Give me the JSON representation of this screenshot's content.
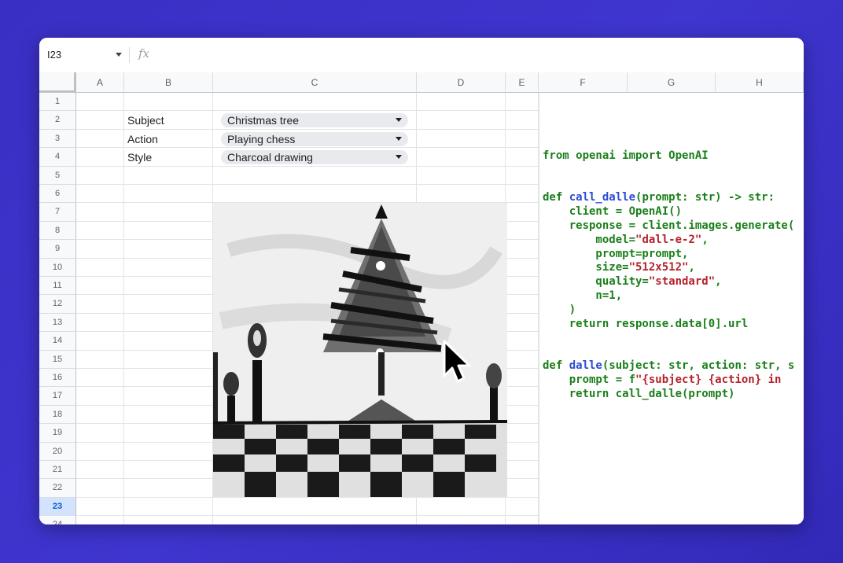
{
  "formula_bar": {
    "cell_ref": "I23",
    "fx_symbol": "fx",
    "formula": ""
  },
  "columns": [
    "A",
    "B",
    "C",
    "D",
    "E",
    "F",
    "G",
    "H"
  ],
  "rows": [
    "1",
    "2",
    "3",
    "4",
    "5",
    "6",
    "7",
    "8",
    "9",
    "10",
    "11",
    "12",
    "13",
    "14",
    "15",
    "16",
    "17",
    "18",
    "19",
    "20",
    "21",
    "22",
    "23",
    "24"
  ],
  "active_row": "23",
  "inputs": [
    {
      "label": "Subject",
      "value": "Christmas tree"
    },
    {
      "label": "Action",
      "value": "Playing chess"
    },
    {
      "label": "Style",
      "value": "Charcoal drawing"
    }
  ],
  "code_lines": [
    "from openai import OpenAI",
    "",
    "",
    "def call_dalle(prompt: str) -> str:",
    "    client = OpenAI()",
    "    response = client.images.generate(",
    "        model=\"dall-e-2\",",
    "        prompt=prompt,",
    "        size=\"512x512\",",
    "        quality=\"standard\",",
    "        n=1,",
    "    )",
    "    return response.data[0].url",
    "",
    "",
    "def dalle(subject: str, action: str, s",
    "    prompt = f\"{subject} {action} in ",
    "    return call_dalle(prompt)"
  ],
  "image": {
    "icon": "charcoal-christmas-tree-chess-image"
  },
  "colors": {
    "background": "#3a2fc4",
    "active_row_header": "#d3e3fd",
    "code_green": "#1a7f1a",
    "code_string": "#b5222b",
    "code_function": "#2a4bd7"
  }
}
